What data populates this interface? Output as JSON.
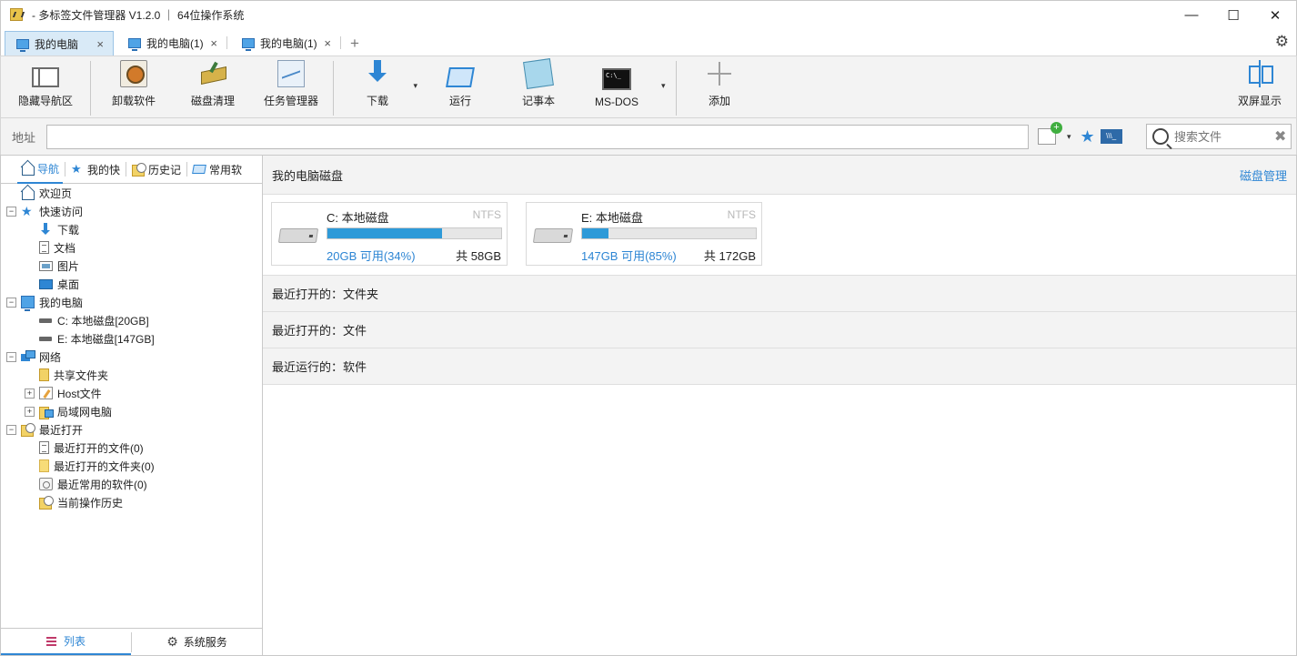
{
  "window": {
    "title": "- 多标签文件管理器 V1.2.0 ｜ 64位操作系统",
    "minimize": "—",
    "maximize": "☐",
    "close": "✕"
  },
  "tabs": {
    "items": [
      {
        "label": "我的电脑",
        "active": true
      },
      {
        "label": "我的电脑(1)",
        "active": false
      },
      {
        "label": "我的电脑(1)",
        "active": false
      }
    ],
    "close_glyph": "×",
    "add_glyph": "+",
    "settings_glyph": "⚙"
  },
  "toolbar": {
    "hide_nav": "隐藏导航区",
    "uninstall": "卸载软件",
    "disk_clean": "磁盘清理",
    "task_manager": "任务管理器",
    "download": "下载",
    "run": "运行",
    "notepad": "记事本",
    "msdos": "MS-DOS",
    "add": "添加",
    "dual_screen": "双屏显示",
    "dropdown_glyph": "▾"
  },
  "address": {
    "label": "地址",
    "value": "",
    "search_placeholder": "搜索文件",
    "clear_glyph": "✖"
  },
  "left": {
    "tabs": [
      "导航",
      "我的快",
      "历史记",
      "常用软"
    ],
    "tree": [
      {
        "label": "欢迎页",
        "level": 0,
        "expander": "",
        "icon": "home-icon"
      },
      {
        "label": "快速访问",
        "level": 0,
        "expander": "−",
        "icon": "star-icon"
      },
      {
        "label": "下载",
        "level": 1,
        "expander": "",
        "icon": "download-icon"
      },
      {
        "label": "文档",
        "level": 1,
        "expander": "",
        "icon": "document-icon"
      },
      {
        "label": "图片",
        "level": 1,
        "expander": "",
        "icon": "picture-icon"
      },
      {
        "label": "桌面",
        "level": 1,
        "expander": "",
        "icon": "desktop-icon"
      },
      {
        "label": "我的电脑",
        "level": 0,
        "expander": "−",
        "icon": "computer-icon"
      },
      {
        "label": "C: 本地磁盘[20GB]",
        "level": 1,
        "expander": "",
        "icon": "drive-icon"
      },
      {
        "label": "E: 本地磁盘[147GB]",
        "level": 1,
        "expander": "",
        "icon": "drive-icon"
      },
      {
        "label": "网络",
        "level": 0,
        "expander": "−",
        "icon": "network-icon"
      },
      {
        "label": "共享文件夹",
        "level": 1,
        "expander": "",
        "icon": "shared-folder-icon"
      },
      {
        "label": "Host文件",
        "level": 1,
        "expander": "+",
        "icon": "host-file-icon"
      },
      {
        "label": "局域网电脑",
        "level": 1,
        "expander": "+",
        "icon": "lan-computer-icon"
      },
      {
        "label": "最近打开",
        "level": 0,
        "expander": "−",
        "icon": "recent-icon"
      },
      {
        "label": "最近打开的文件(0)",
        "level": 1,
        "expander": "",
        "icon": "document-icon"
      },
      {
        "label": "最近打开的文件夹(0)",
        "level": 1,
        "expander": "",
        "icon": "folder-icon"
      },
      {
        "label": "最近常用的软件(0)",
        "level": 1,
        "expander": "",
        "icon": "software-icon"
      },
      {
        "label": "当前操作历史",
        "level": 1,
        "expander": "",
        "icon": "history-icon"
      }
    ],
    "bottom_tabs": [
      "列表",
      "系统服务"
    ]
  },
  "main": {
    "disks_title": "我的电脑磁盘",
    "disk_manage_link": "磁盘管理",
    "drives": [
      {
        "name": "C: 本地磁盘",
        "fs": "NTFS",
        "free": "20GB 可用(34%)",
        "total": "共 58GB",
        "used_fraction": 0.66
      },
      {
        "name": "E: 本地磁盘",
        "fs": "NTFS",
        "free": "147GB 可用(85%)",
        "total": "共 172GB",
        "used_fraction": 0.15
      }
    ],
    "recent_sections": [
      "最近打开的：文件夹",
      "最近打开的：文件",
      "最近运行的：软件"
    ]
  },
  "colors": {
    "accent": "#2e86d4",
    "bar_fill": "#2e9ad8",
    "toolbar_bg": "#f3f3f3"
  }
}
